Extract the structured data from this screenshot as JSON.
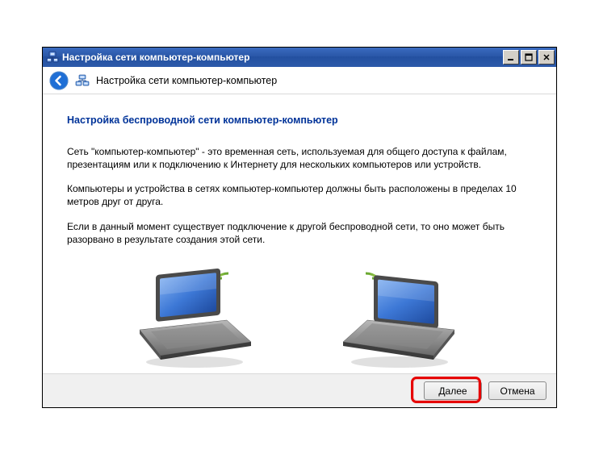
{
  "window": {
    "title": "Настройка сети компьютер-компьютер"
  },
  "header": {
    "title": "Настройка сети компьютер-компьютер"
  },
  "content": {
    "heading": "Настройка беспроводной сети компьютер-компьютер",
    "p1": "Сеть \"компьютер-компьютер\" - это временная сеть, используемая для общего доступа к файлам, презентациям или к подключению к Интернету для нескольких компьютеров или устройств.",
    "p2": "Компьютеры и устройства в сетях компьютер-компьютер должны быть расположены в пределах 10 метров друг от друга.",
    "p3": "Если в данный момент существует подключение к другой беспроводной сети, то оно может быть разорвано в результате создания этой сети."
  },
  "footer": {
    "next": "Далее",
    "cancel": "Отмена"
  }
}
